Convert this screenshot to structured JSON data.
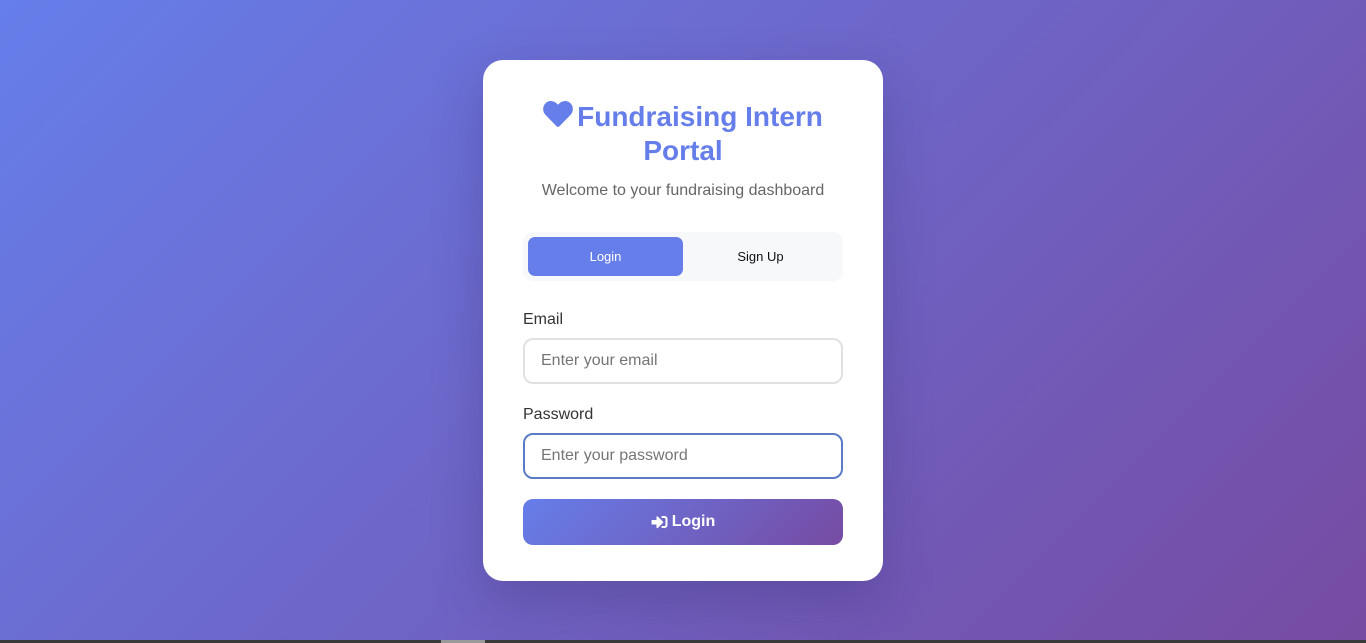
{
  "header": {
    "title": "Fundraising Intern Portal",
    "subtitle": "Welcome to your fundraising dashboard",
    "icon": "heart-icon"
  },
  "tabs": [
    {
      "label": "Login",
      "active": true
    },
    {
      "label": "Sign Up",
      "active": false
    }
  ],
  "form": {
    "email": {
      "label": "Email",
      "value": "",
      "placeholder": "Enter your email"
    },
    "password": {
      "label": "Password",
      "value": "",
      "placeholder": "Enter your password",
      "focused": true
    },
    "submit": {
      "label": "Login",
      "icon": "sign-in-icon"
    }
  },
  "colors": {
    "accent": "#667eea",
    "gradient_end": "#764ba2",
    "focus_border": "#5a7cc7"
  }
}
